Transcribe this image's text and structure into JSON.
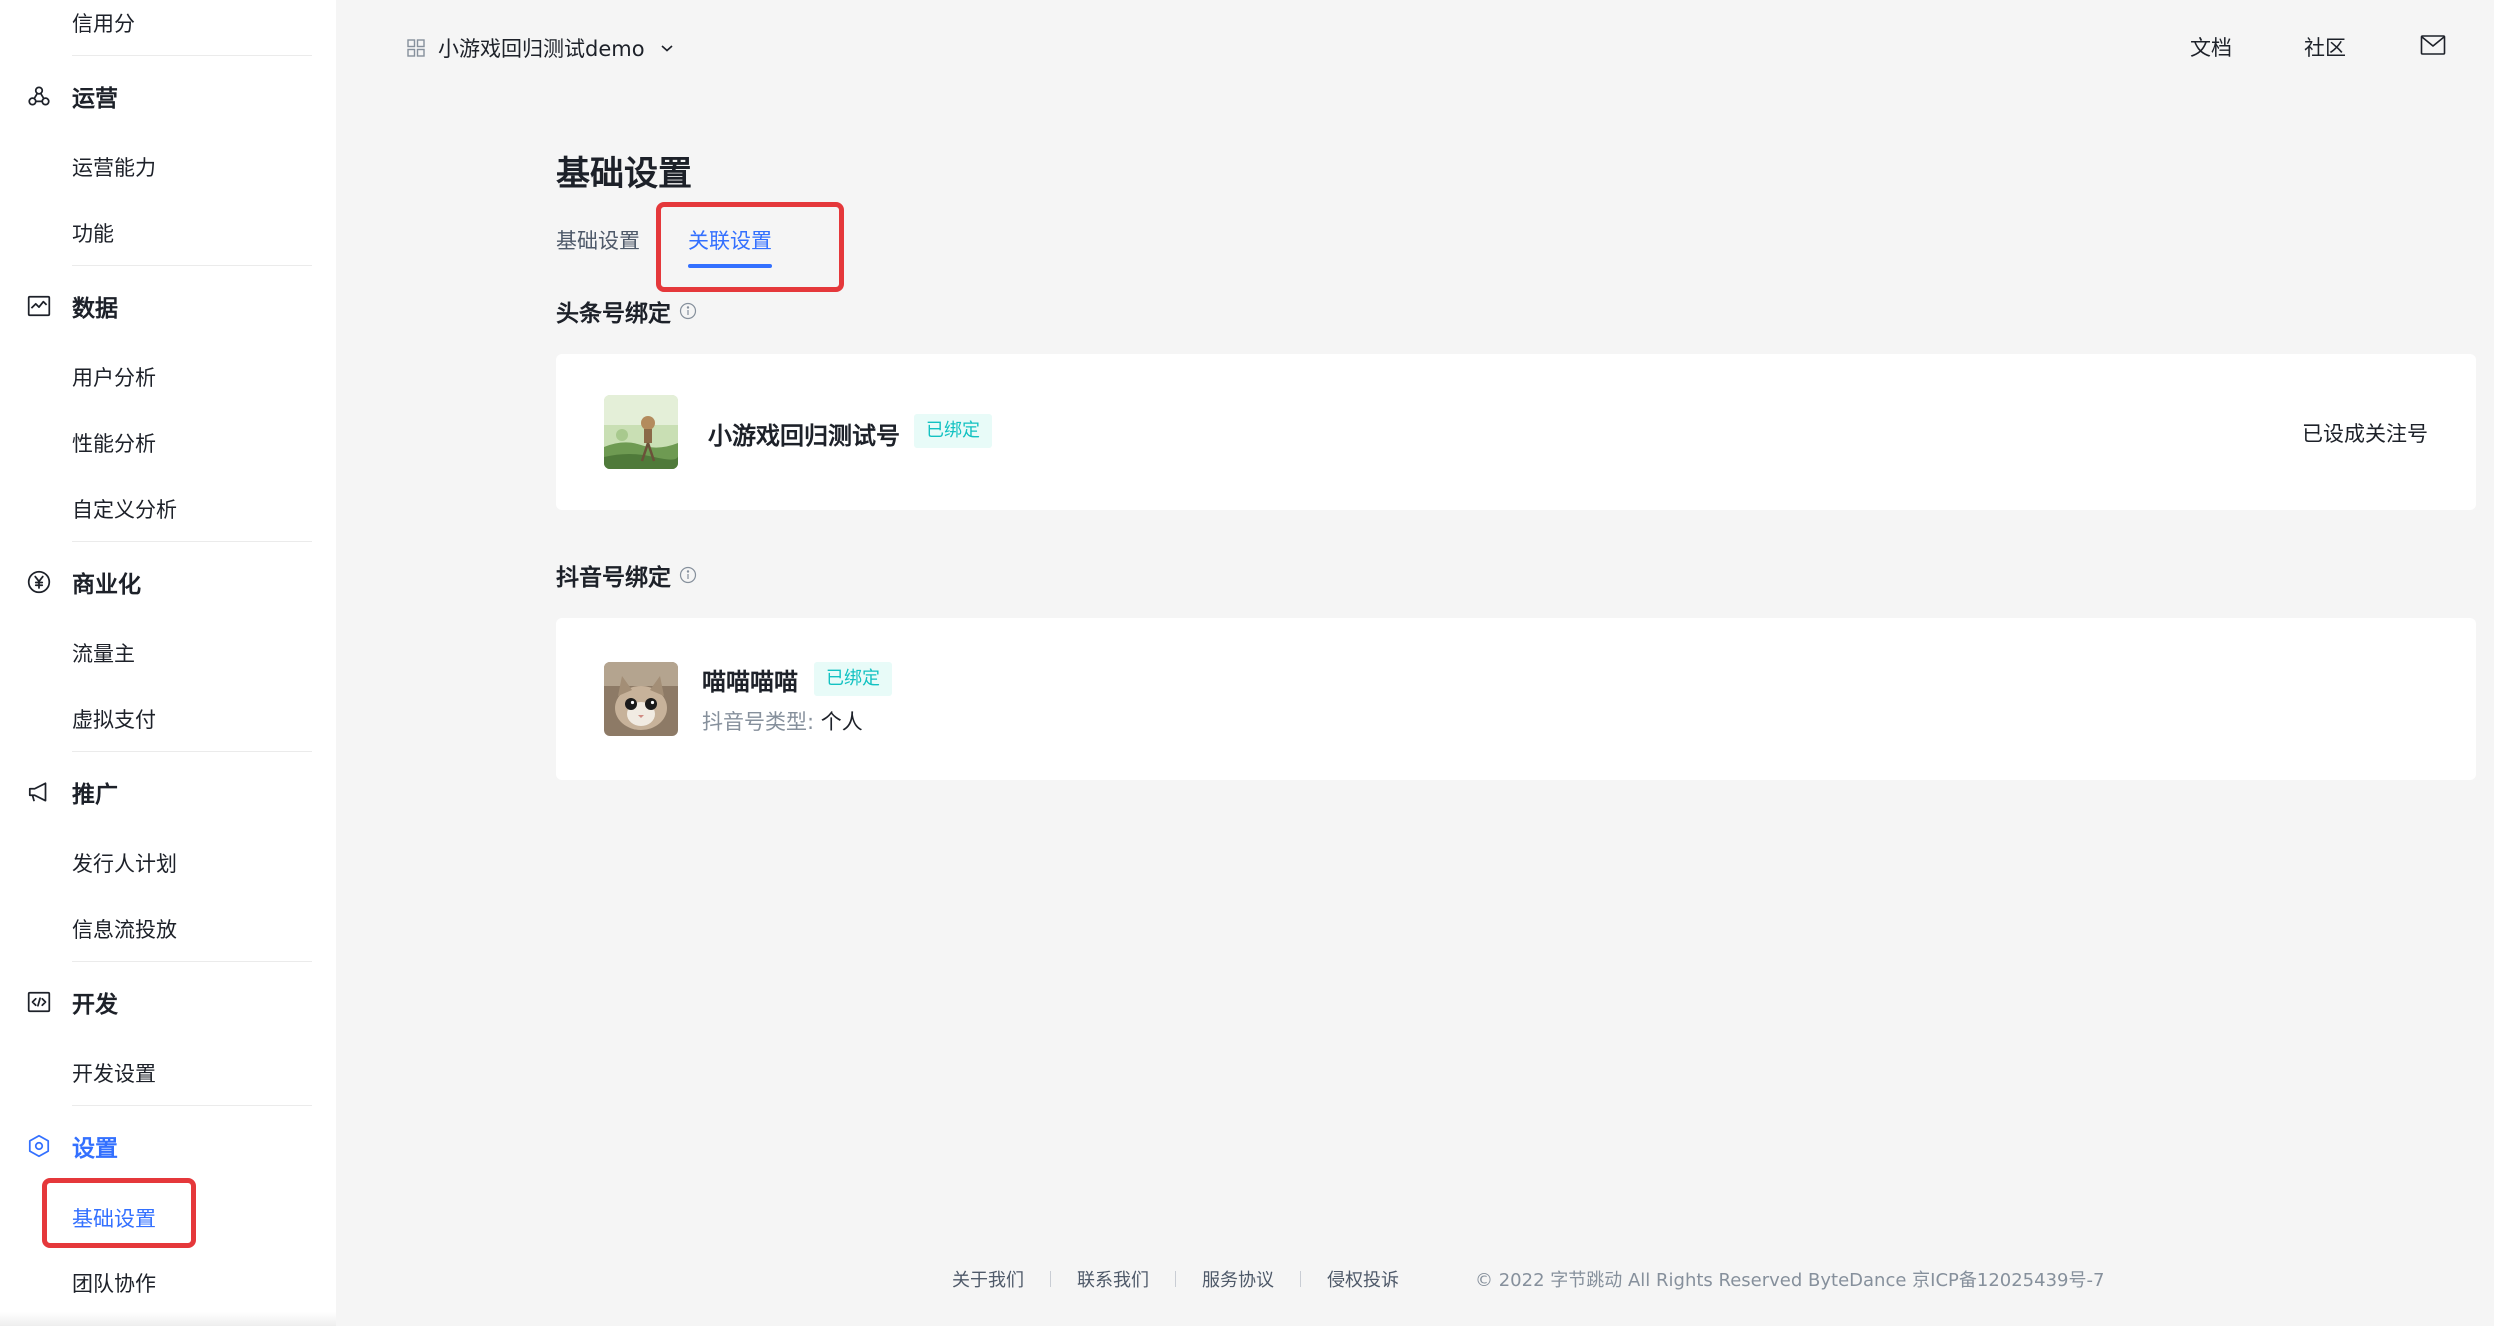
{
  "sidebar": {
    "credit_item": "信用分",
    "groups": [
      {
        "label": "运营",
        "icon": "operations-icon",
        "items": [
          "运营能力",
          "功能"
        ]
      },
      {
        "label": "数据",
        "icon": "data-chart-icon",
        "items": [
          "用户分析",
          "性能分析",
          "自定义分析"
        ]
      },
      {
        "label": "商业化",
        "icon": "yen-coin-icon",
        "items": [
          "流量主",
          "虚拟支付"
        ]
      },
      {
        "label": "推广",
        "icon": "megaphone-icon",
        "items": [
          "发行人计划",
          "信息流投放"
        ]
      },
      {
        "label": "开发",
        "icon": "code-icon",
        "items": [
          "开发设置"
        ]
      },
      {
        "label": "设置",
        "icon": "settings-hex-icon",
        "items": [
          "基础设置",
          "团队协作"
        ]
      }
    ],
    "active_item": "基础设置"
  },
  "topbar": {
    "app_name": "小游戏回归测试demo",
    "links": [
      "文档",
      "社区"
    ],
    "mail_icon": "mail-icon"
  },
  "page": {
    "title": "基础设置",
    "tabs": [
      "基础设置",
      "关联设置"
    ],
    "active_tab": "关联设置"
  },
  "toutiao": {
    "section_title": "头条号绑定",
    "account_name": "小游戏回归测试号",
    "badge": "已绑定",
    "status": "已设成关注号"
  },
  "douyin": {
    "section_title": "抖音号绑定",
    "account_name": "喵喵喵喵",
    "badge": "已绑定",
    "type_label": "抖音号类型:",
    "type_value": "个人"
  },
  "footer": {
    "links": [
      "关于我们",
      "联系我们",
      "服务协议",
      "侵权投诉"
    ],
    "copyright": "© 2022 字节跳动 All Rights Reserved ByteDance 京ICP备12025439号-7"
  },
  "colors": {
    "accent": "#3370ff",
    "highlight": "#e5383b",
    "badge_text": "#13c2c2",
    "badge_bg": "#e8fbf8"
  }
}
